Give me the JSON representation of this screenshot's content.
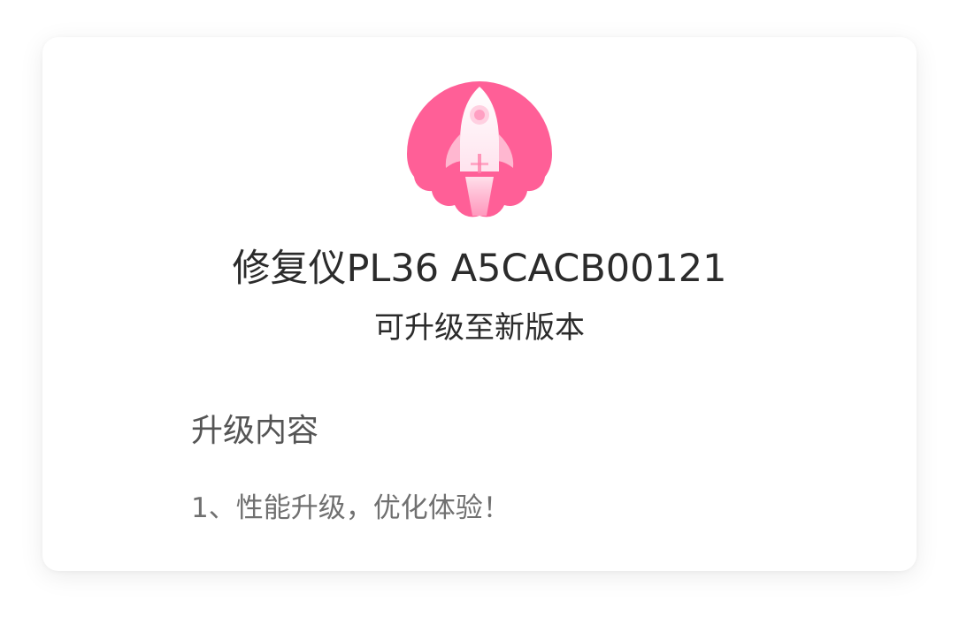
{
  "dialog": {
    "icon": "rocket-icon",
    "title": "修复仪PL36 A5CACB00121",
    "subtitle": "可升级至新版本",
    "section_heading": "升级内容",
    "section_text": "1、性能升级，优化体验！",
    "accent_color": "#ff5f97"
  }
}
